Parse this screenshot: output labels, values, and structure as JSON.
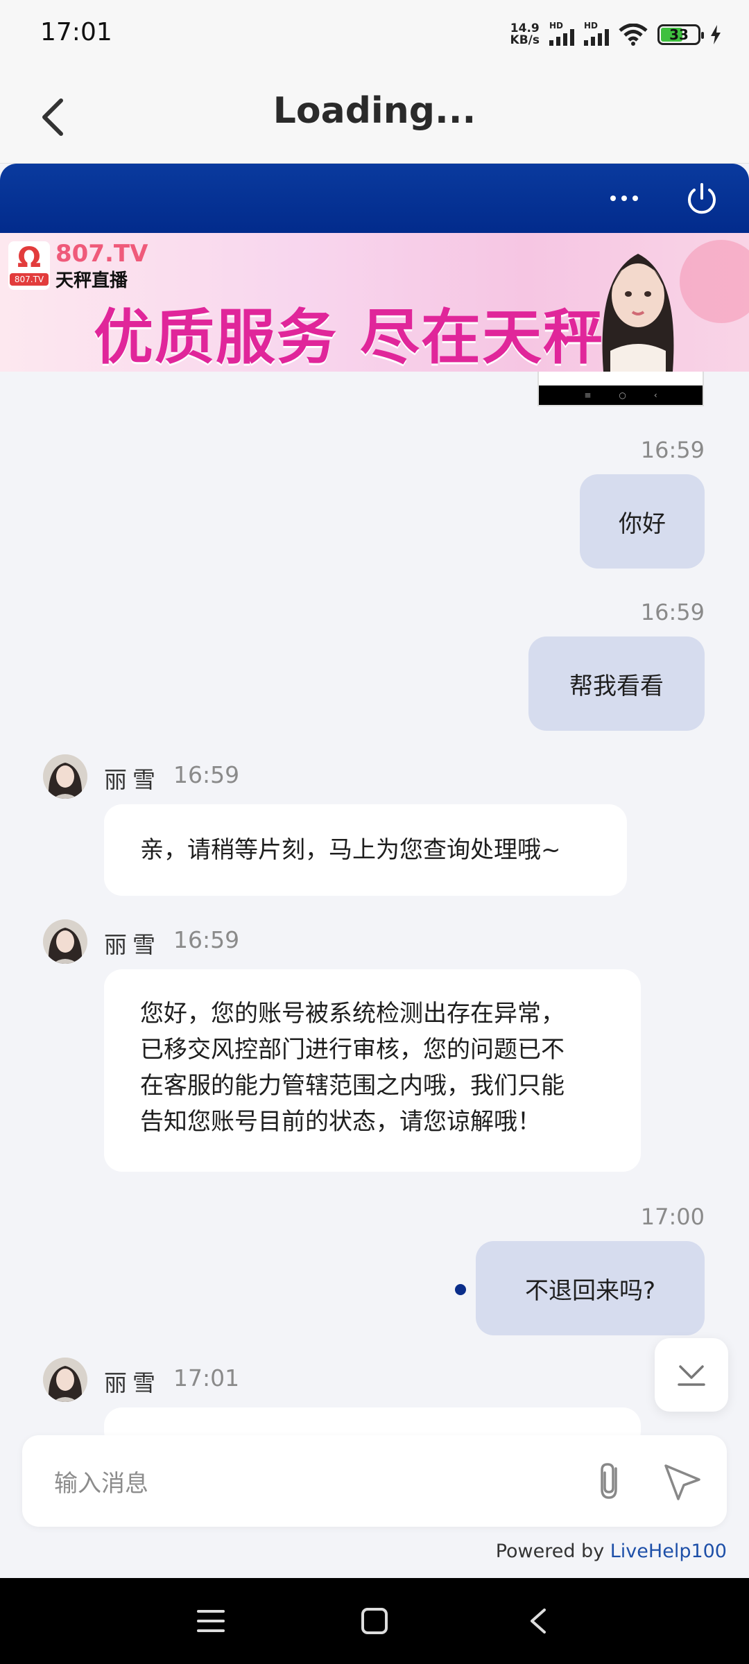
{
  "status_bar": {
    "time": "17:01",
    "net_speed_value": "14.9",
    "net_speed_unit": "KB/s",
    "signal1_label": "HD",
    "signal2_label": "HD",
    "battery_level": "33"
  },
  "header": {
    "title": "Loading..."
  },
  "banner": {
    "site": "807.TV",
    "brand": "天秤直播",
    "slogan": "优质服务 尽在天秤",
    "logo_small": "807.TV"
  },
  "messages": [
    {
      "side": "right",
      "time": "16:59",
      "text": "你好"
    },
    {
      "side": "right",
      "time": "16:59",
      "text": "帮我看看"
    },
    {
      "side": "left",
      "name": "丽雪",
      "time": "16:59",
      "text": "亲，请稍等片刻，马上为您查询处理哦~"
    },
    {
      "side": "left",
      "name": "丽雪",
      "time": "16:59",
      "lines": [
        "您好，您的账号被系统检测出存在异常，",
        "已移交风控部门进行审核，您的问题已不",
        "在客服的能力管辖范围之内哦，我们只能",
        "告知您账号目前的状态，请您谅解哦！"
      ]
    },
    {
      "side": "right",
      "time": "17:00",
      "text": "不退回来吗?"
    },
    {
      "side": "left",
      "name": "丽雪",
      "time": "17:01",
      "text": ""
    }
  ],
  "input": {
    "placeholder": "输入消息"
  },
  "footer": {
    "powered_prefix": "Powered by ",
    "powered_link": "LiveHelp100"
  },
  "colors": {
    "header_blue": "#022b8c",
    "bubble_right": "#d6dcee",
    "bubble_left": "#ffffff",
    "background": "#f3f4f8",
    "link": "#1d4fa8"
  }
}
